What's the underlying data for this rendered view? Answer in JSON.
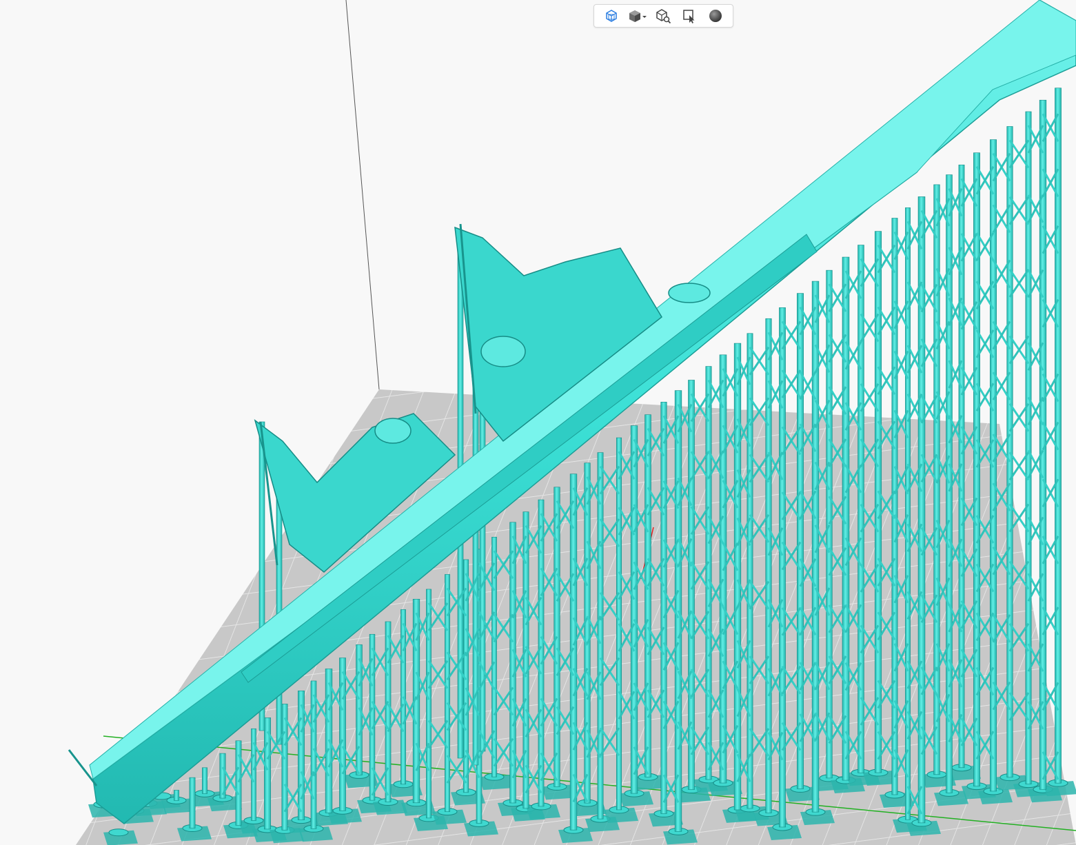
{
  "app": {
    "view": "3d-viewport"
  },
  "toolbar": {
    "buttons": [
      {
        "name": "perspective-view",
        "icon": "wireframe-cube-icon",
        "active": true
      },
      {
        "name": "shaded-view-menu",
        "icon": "solid-cube-dropdown-icon",
        "active": false
      },
      {
        "name": "inspect-model",
        "icon": "cube-search-icon",
        "active": false
      },
      {
        "name": "select-tool",
        "icon": "select-cursor-icon",
        "active": false
      },
      {
        "name": "material-sphere",
        "icon": "sphere-icon",
        "active": false
      }
    ]
  },
  "colors": {
    "model": "#3ce0d6",
    "model_shadow": "#1aa8a2",
    "support_base": "#2bb5ad",
    "bed": "#c6c6c6",
    "bed_grid": "#e2e2e2",
    "background": "#f8f8f8",
    "axis_red": "#e02020",
    "axis_green": "#22b022",
    "active_icon": "#2a7de1"
  }
}
